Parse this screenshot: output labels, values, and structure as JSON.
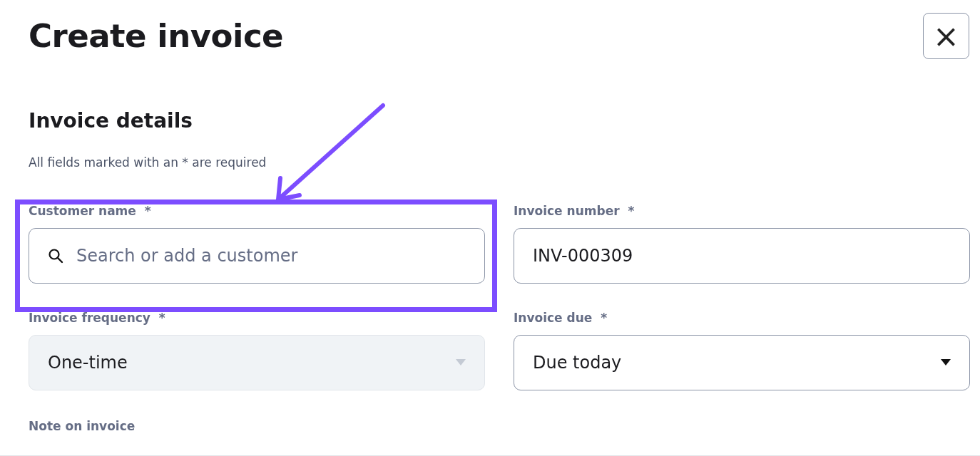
{
  "title": "Create invoice",
  "close_button": {
    "label": "×"
  },
  "section": {
    "heading": "Invoice details",
    "hint": "All fields marked with an * are required"
  },
  "fields": [
    {
      "kind": "search",
      "label": "Customer name  *",
      "placeholder": "Search or add a customer",
      "disabled": false
    },
    {
      "kind": "text",
      "label": "Invoice number  *",
      "value": "INV-000309",
      "disabled": false
    },
    {
      "kind": "select",
      "label": "Invoice frequency  *",
      "value": "One-time",
      "disabled": true
    },
    {
      "kind": "select",
      "label": "Invoice due  *",
      "value": "Due today",
      "disabled": false
    }
  ],
  "note": {
    "label": "Note on invoice"
  }
}
